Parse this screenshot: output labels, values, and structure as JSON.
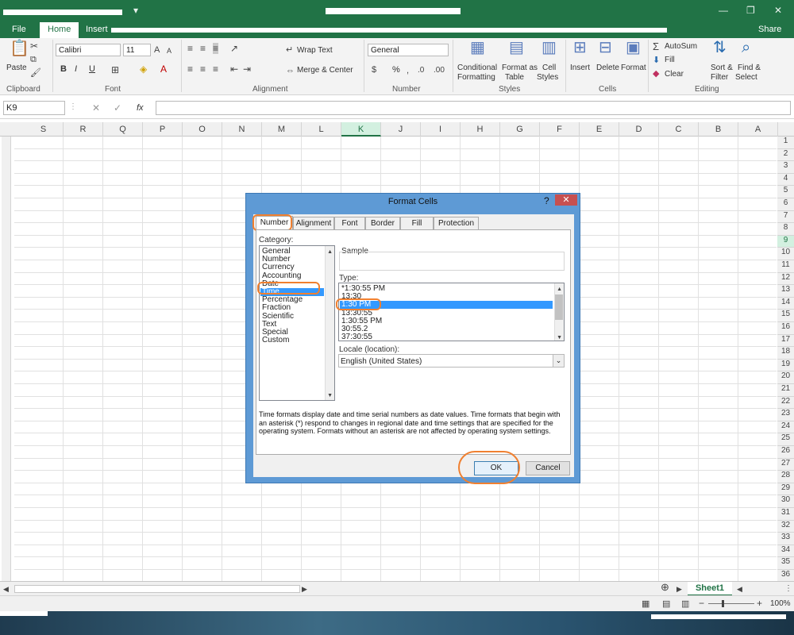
{
  "tabs": [
    "File",
    "Home",
    "Insert"
  ],
  "ribbon": {
    "clipboard": {
      "paste": "Paste",
      "label": "Clipboard"
    },
    "font": {
      "name": "Calibri",
      "size": "11",
      "label": "Font",
      "bold": "B",
      "italic": "I",
      "underline": "U"
    },
    "alignment": {
      "wrap_text": "Wrap Text",
      "merge_center": "Merge & Center",
      "label": "Alignment"
    },
    "number": {
      "format": "General",
      "percent": "%",
      "label": "Number"
    },
    "styles": {
      "conditional": "Conditional",
      "formatting": "Formatting",
      "format_as": "Format as",
      "table": "Table",
      "cell": "Cell",
      "cell_styles": "Styles",
      "label": "Styles"
    },
    "cells": {
      "insert": "Insert",
      "delete": "Delete",
      "format": "Format",
      "label": "Cells"
    },
    "editing": {
      "autosum": "AutoSum",
      "fill": "Fill",
      "clear": "Clear",
      "sort": "Sort &",
      "filter": "Filter",
      "find": "Find &",
      "select": "Select",
      "label": "Editing"
    },
    "share": "Share"
  },
  "formula_bar": {
    "name_box": "K9",
    "fx": "fx"
  },
  "columns": [
    "S",
    "R",
    "Q",
    "P",
    "O",
    "N",
    "M",
    "L",
    "K",
    "J",
    "I",
    "H",
    "G",
    "F",
    "E",
    "D",
    "C",
    "B",
    "A"
  ],
  "selected_column": "K",
  "rows": [
    "1",
    "2",
    "3",
    "4",
    "5",
    "6",
    "7",
    "8",
    "9",
    "10",
    "11",
    "12",
    "13",
    "14",
    "15",
    "16",
    "17",
    "18",
    "19",
    "20",
    "21",
    "22",
    "23",
    "24",
    "25",
    "26",
    "27",
    "28",
    "29",
    "30",
    "31",
    "32",
    "33",
    "34",
    "35",
    "36"
  ],
  "selected_row": "9",
  "sheet_tab": "Sheet1",
  "zoom": "100%",
  "dialog": {
    "title": "Format Cells",
    "help": "?",
    "close": "✕",
    "tabs": [
      "Number",
      "Alignment",
      "Font",
      "Border",
      "Fill",
      "Protection"
    ],
    "category_label": "Category:",
    "categories": [
      "General",
      "Number",
      "Currency",
      "Accounting",
      "Date",
      "Time",
      "Percentage",
      "Fraction",
      "Scientific",
      "Text",
      "Special",
      "Custom"
    ],
    "selected_category": "Time",
    "sample_label": "Sample",
    "type_label": "Type:",
    "types": [
      "*1:30:55 PM",
      "13:30",
      "1:30 PM",
      "13:30:55",
      "1:30:55 PM",
      "30:55.2",
      "37:30:55"
    ],
    "selected_type": "1:30 PM",
    "locale_label": "Locale (location):",
    "locale_value": "English (United States)",
    "description": "Time formats display date and time serial numbers as date values.  Time formats that begin with an asterisk (*) respond to changes in regional date and time settings that are specified for the operating system. Formats without an asterisk are not affected by operating system settings.",
    "ok": "OK",
    "cancel": "Cancel"
  }
}
